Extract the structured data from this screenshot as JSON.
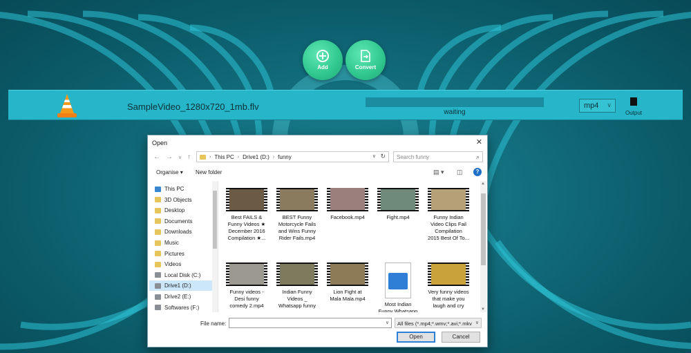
{
  "toolbar": {
    "add_label": "Add",
    "convert_label": "Convert"
  },
  "task": {
    "filename": "SampleVideo_1280x720_1mb.flv",
    "status": "waiting",
    "progress": 0,
    "format": "mp4",
    "output_label": "Output"
  },
  "dialog": {
    "title": "Open",
    "breadcrumb": [
      "This PC",
      "Drive1 (D:)",
      "funny"
    ],
    "search_placeholder": "Search funny",
    "organise_label": "Organise",
    "new_folder_label": "New folder",
    "nav_items": [
      {
        "label": "This PC",
        "icon": "computer-icon"
      },
      {
        "label": "3D Objects",
        "icon": "folder-icon"
      },
      {
        "label": "Desktop",
        "icon": "folder-icon"
      },
      {
        "label": "Documents",
        "icon": "folder-icon"
      },
      {
        "label": "Downloads",
        "icon": "folder-icon"
      },
      {
        "label": "Music",
        "icon": "folder-icon"
      },
      {
        "label": "Pictures",
        "icon": "folder-icon"
      },
      {
        "label": "Videos",
        "icon": "folder-icon"
      },
      {
        "label": "Local Disk (C:)",
        "icon": "drive-icon"
      },
      {
        "label": "Drive1 (D:)",
        "icon": "drive-icon",
        "selected": true
      },
      {
        "label": "Drive2 (E:)",
        "icon": "drive-icon"
      },
      {
        "label": "Softwares (F:)",
        "icon": "drive-icon"
      }
    ],
    "files": [
      {
        "lines": [
          "Best FAILS &",
          "Funny Videos ★",
          "December 2016",
          "Compilation ★..."
        ]
      },
      {
        "lines": [
          "BEST Funny",
          "Motorcycle Fails",
          "and Wins Funny",
          "Rider Fails.mp4"
        ]
      },
      {
        "lines": [
          "Facebook.mp4"
        ]
      },
      {
        "lines": [
          "Fight.mp4"
        ]
      },
      {
        "lines": [
          "Funny Indian",
          "Video Clips Fail",
          "Compilation",
          "2015 Best Of To..."
        ]
      },
      {
        "lines": [
          "Funny videos -",
          "Desi funny",
          "comedy 2.mp4"
        ]
      },
      {
        "lines": [
          "Indian Funny",
          "Videos _",
          "Whatsapp funny"
        ]
      },
      {
        "lines": [
          "Lion Fight at",
          "Mala Mala.mp4"
        ]
      },
      {
        "lines": [
          "Most Indian",
          "Funny Whatsapp",
          "Videos _ Try Not"
        ]
      },
      {
        "lines": [
          "Very funny videos",
          "that make you",
          "laugh and cry"
        ]
      }
    ],
    "filename_label": "File name:",
    "filename_value": "",
    "filetype_value": "All files (*.mp4;*.wmv;*.avi;*.mkv",
    "open_label": "Open",
    "cancel_label": "Cancel"
  }
}
